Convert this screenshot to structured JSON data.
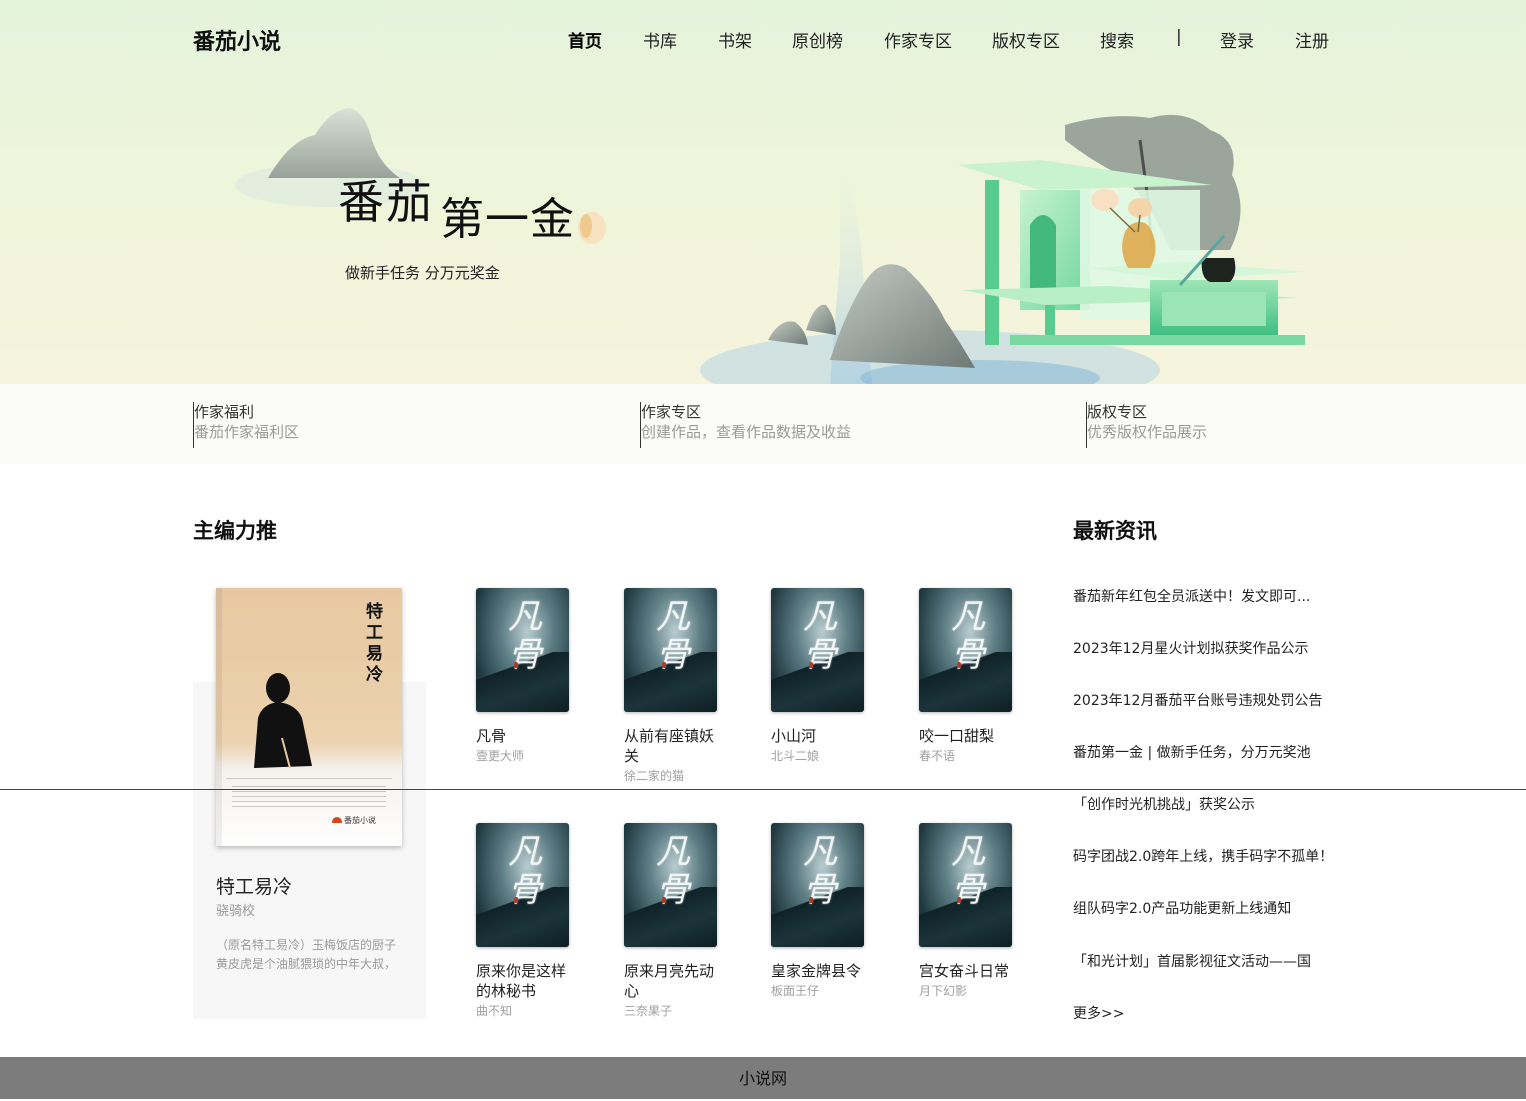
{
  "site": {
    "logo": "番茄小说"
  },
  "nav": {
    "items": [
      "首页",
      "书库",
      "书架",
      "原创榜",
      "作家专区",
      "版权专区",
      "搜索"
    ],
    "separator": "|",
    "login": "登录",
    "register": "注册"
  },
  "hero": {
    "title_a": "番茄",
    "title_b": "第一金",
    "subtitle": "做新手任务  分万元奖金"
  },
  "features": [
    {
      "title": "作家福利",
      "desc": "番茄作家福利区"
    },
    {
      "title": "作家专区",
      "desc": "创建作品，查看作品数据及收益"
    },
    {
      "title": "版权专区",
      "desc": "优秀版权作品展示"
    }
  ],
  "recommend": {
    "title": "主编力推",
    "featured": {
      "cover_title": "特工易冷",
      "cover_brand": "番茄小说",
      "name": "特工易冷",
      "author": "骁骑校",
      "intro": "（原名特工易冷）玉梅饭店的厨子黄皮虎是个油腻猥琐的中年大叔，喜欢"
    },
    "cover_glyph": "凡骨",
    "books": [
      {
        "title": "凡骨",
        "author": "壹更大师"
      },
      {
        "title": "从前有座镇妖关",
        "author": "徐二家的猫"
      },
      {
        "title": "小山河",
        "author": "北斗二娘"
      },
      {
        "title": "咬一口甜梨",
        "author": "春不语"
      },
      {
        "title": "原来你是这样的林秘书",
        "author": "曲不知"
      },
      {
        "title": "原来月亮先动心",
        "author": "三奈果子"
      },
      {
        "title": "皇家金牌县令",
        "author": "板面王仔"
      },
      {
        "title": "宫女奋斗日常",
        "author": "月下幻影"
      }
    ]
  },
  "news": {
    "title": "最新资讯",
    "items": [
      "番茄新年红包全员派送中！发文即可...",
      "2023年12月星火计划拟获奖作品公示",
      "2023年12月番茄平台账号违规处罚公告",
      "番茄第一金 | 做新手任务，分万元奖池",
      "「创作时光机挑战」获奖公示",
      "码字团战2.0跨年上线，携手码字不孤单！",
      "组队码字2.0产品功能更新上线通知",
      "「和光计划」首届影视征文活动——国"
    ],
    "more": "更多>>"
  },
  "footer": {
    "text": "小说网"
  }
}
